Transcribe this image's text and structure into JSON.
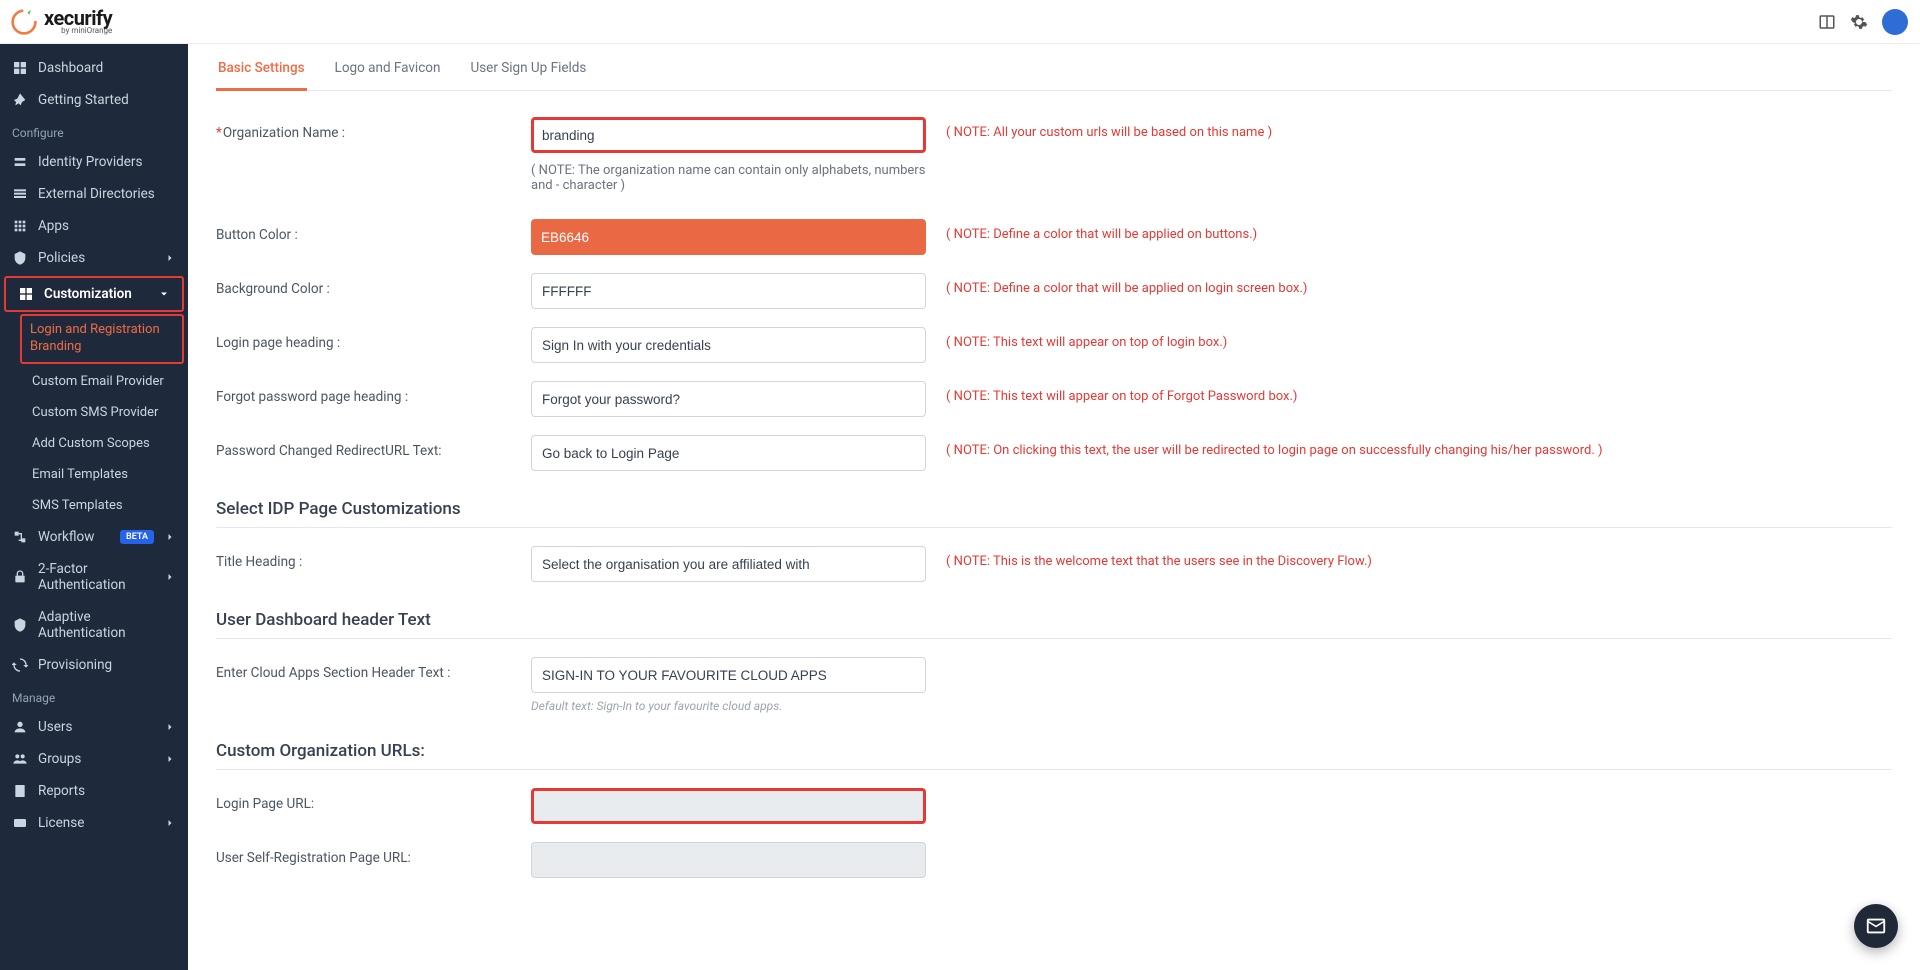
{
  "brand": {
    "name": "xecurify",
    "sub": "by miniOrange"
  },
  "sidebar": {
    "items": [
      {
        "label": "Dashboard"
      },
      {
        "label": "Getting Started"
      }
    ],
    "configure_label": "Configure",
    "configure_items": [
      {
        "label": "Identity Providers"
      },
      {
        "label": "External Directories"
      },
      {
        "label": "Apps"
      },
      {
        "label": "Policies"
      },
      {
        "label": "Customization"
      }
    ],
    "custom_sub": [
      {
        "label": "Login and Registration Branding"
      },
      {
        "label": "Custom Email Provider"
      },
      {
        "label": "Custom SMS Provider"
      },
      {
        "label": "Add Custom Scopes"
      },
      {
        "label": "Email Templates"
      },
      {
        "label": "SMS Templates"
      }
    ],
    "more_items": [
      {
        "label": "Workflow",
        "badge": "BETA"
      },
      {
        "label": "2-Factor Authentication"
      },
      {
        "label": "Adaptive Authentication"
      },
      {
        "label": "Provisioning"
      }
    ],
    "manage_label": "Manage",
    "manage_items": [
      {
        "label": "Users"
      },
      {
        "label": "Groups"
      },
      {
        "label": "Reports"
      },
      {
        "label": "License"
      }
    ]
  },
  "tabs": [
    {
      "label": "Basic Settings"
    },
    {
      "label": "Logo and Favicon"
    },
    {
      "label": "User Sign Up Fields"
    }
  ],
  "form": {
    "org_name_label": "Organization Name :",
    "org_name_value": "branding",
    "org_name_note": "( NOTE: All your custom urls will be based on this name )",
    "org_name_subnote": "( NOTE: The organization name can contain only alphabets, numbers and - character )",
    "button_color_label": "Button Color :",
    "button_color_value": "EB6646",
    "button_color_note": "( NOTE: Define a color that will be applied on buttons.)",
    "bg_color_label": "Background Color :",
    "bg_color_value": "FFFFFF",
    "bg_color_note": "( NOTE: Define a color that will be applied on login screen box.)",
    "login_heading_label": "Login page heading :",
    "login_heading_value": "Sign In with your credentials",
    "login_heading_note": "( NOTE: This text will appear on top of login box.)",
    "forgot_label": "Forgot password page heading :",
    "forgot_value": "Forgot your password?",
    "forgot_note": "( NOTE: This text will appear on top of Forgot Password box.)",
    "pwd_redirect_label": "Password Changed RedirectURL Text:",
    "pwd_redirect_value": "Go back to Login Page",
    "pwd_redirect_note": "( NOTE: On clicking this text, the user will be redirected to login page on successfully changing his/her password. )",
    "idp_section": "Select IDP Page Customizations",
    "title_heading_label": "Title Heading :",
    "title_heading_value": "Select the organisation you are affiliated with",
    "title_heading_note": "( NOTE: This is the welcome text that the users see in the Discovery Flow.)",
    "dashboard_section": "User Dashboard header Text",
    "cloud_label": "Enter Cloud Apps Section Header Text :",
    "cloud_value": "SIGN-IN TO YOUR FAVOURITE CLOUD APPS",
    "cloud_subnote": "Default text: Sign-In to your favourite cloud apps.",
    "urls_section": "Custom Organization URLs:",
    "login_url_label": "Login Page URL:",
    "selfreg_url_label": "User Self-Registration Page URL:"
  }
}
